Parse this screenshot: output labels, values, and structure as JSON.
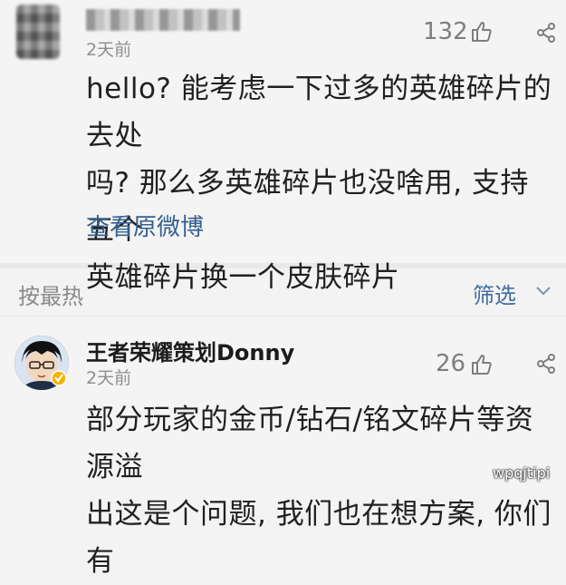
{
  "comment1": {
    "time": "2天前",
    "likes": "132",
    "lines": [
      "hello? 能考虑一下过多的英雄碎片的去处",
      "吗? 那么多英雄碎片也没啥用, 支持五个",
      "英雄碎片换一个皮肤碎片"
    ],
    "view_original": "查看原微博"
  },
  "sortbar": {
    "sort_label": "按最热",
    "filter_label": "筛选"
  },
  "comment2": {
    "username": "王者荣耀策划Donny",
    "time": "2天前",
    "likes": "26",
    "lines": [
      "部分玩家的金币/钻石/铭文碎片等资源溢",
      "出这是个问题, 我们也在想方案, 你们有"
    ]
  },
  "watermark": "wpqjtipi",
  "icons": [
    "thumb-up-icon",
    "share-icon",
    "chevron-down-icon",
    "verified-badge-icon"
  ],
  "colors": {
    "link": "#35608f",
    "filter": "#426ea0",
    "verified": "#f5b400"
  }
}
